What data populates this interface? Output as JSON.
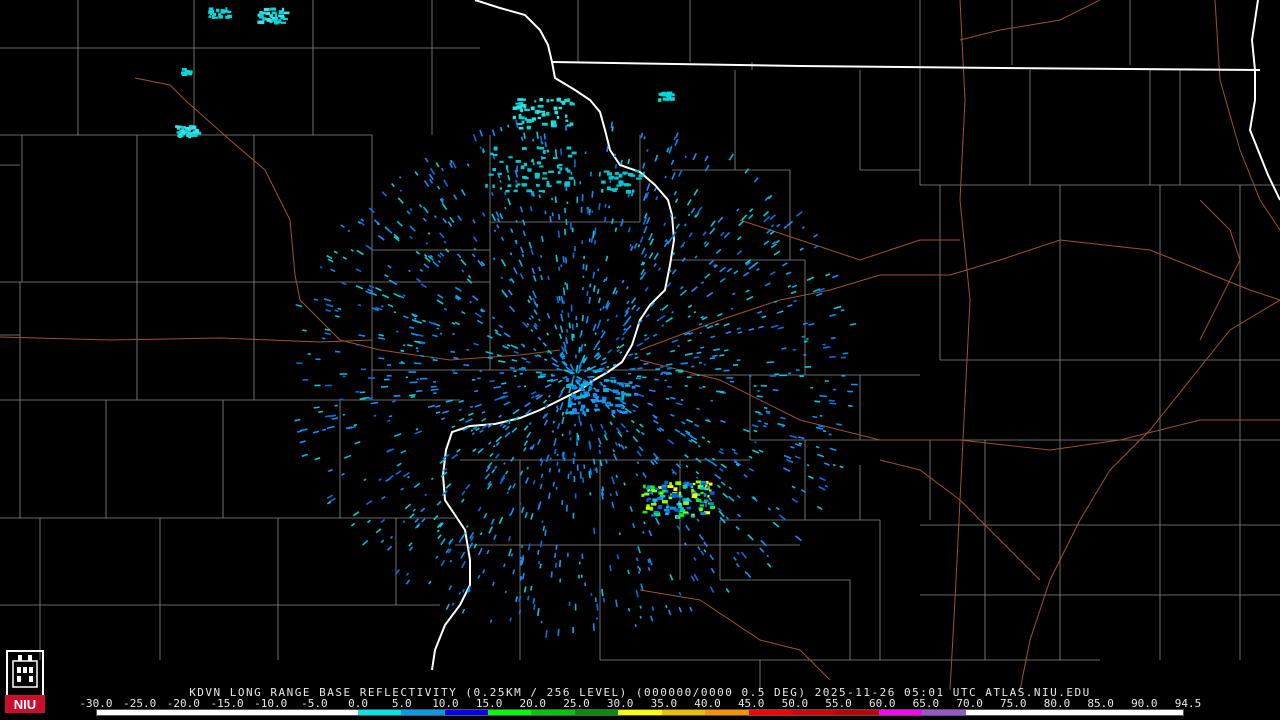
{
  "product": {
    "caption": "KDVN LONG RANGE BASE REFLECTIVITY (0.25KM / 256 LEVEL) (000000/0000 0.5 DEG) 2025-11-26 05:01 UTC  ATLAS.NIU.EDU",
    "station": "KDVN",
    "valid_time": "2025-11-26 05:01 UTC",
    "source": "ATLAS.NIU.EDU"
  },
  "logo": {
    "text": "NIU",
    "color": "#c8102e"
  },
  "colorbar": {
    "labels": [
      "-30.0",
      "-25.0",
      "-20.0",
      "-15.0",
      "-10.0",
      "-5.0",
      "0.0",
      "5.0",
      "10.0",
      "15.0",
      "20.0",
      "25.0",
      "30.0",
      "35.0",
      "40.0",
      "45.0",
      "50.0",
      "55.0",
      "60.0",
      "65.0",
      "70.0",
      "75.0",
      "80.0",
      "85.0",
      "90.0",
      "94.5"
    ],
    "colors": [
      "#ffffff",
      "#ffffff",
      "#ffffff",
      "#ffffff",
      "#ffffff",
      "#ffffff",
      "#00e6e6",
      "#009cf0",
      "#0000f6",
      "#00ff00",
      "#00c800",
      "#008f00",
      "#ffff00",
      "#e7c000",
      "#ff9000",
      "#ff0000",
      "#d60000",
      "#c00000",
      "#ff00ff",
      "#9955c9",
      "#ffffff",
      "#ffffff",
      "#ffffff",
      "#ffffff",
      "#ffffff"
    ]
  },
  "legend_colors": {
    "state_border": "#ffffff",
    "county_border": "#8c8c8c",
    "highway": "#a0522d",
    "background": "#000000"
  },
  "radar": {
    "site_label": "KDVN",
    "echoes": [
      {
        "area": "far northwest",
        "intensity_dbz": 10
      },
      {
        "area": "northeast Iowa river band",
        "intensity_dbz": 8
      },
      {
        "area": "south of radar",
        "intensity_dbz": 40
      }
    ]
  }
}
